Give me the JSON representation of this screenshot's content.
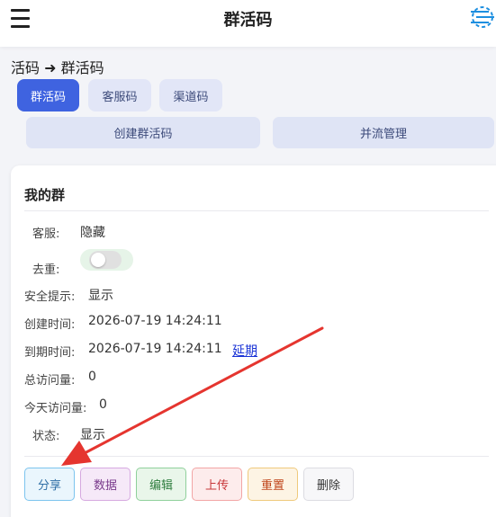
{
  "header": {
    "title": "群活码"
  },
  "breadcrumb": "活码 ➜ 群活码",
  "tabs": [
    {
      "label": "群活码",
      "active": true
    },
    {
      "label": "客服码",
      "active": false
    },
    {
      "label": "渠道码",
      "active": false
    }
  ],
  "actions": {
    "create": "创建群活码",
    "merge": "并流管理"
  },
  "card": {
    "title": "我的群",
    "rows": {
      "service": {
        "label": "客服:",
        "value": "隐藏"
      },
      "dedupe": {
        "label": "去重:",
        "enabled": false
      },
      "safety": {
        "label": "安全提示:",
        "value": "显示"
      },
      "created": {
        "label": "创建时间:",
        "value": "2026-07-19 14:24:11"
      },
      "expire": {
        "label": "到期时间:",
        "value": "2026-07-19 14:24:11",
        "link": "延期"
      },
      "total_visits": {
        "label": "总访问量:",
        "value": "0"
      },
      "today_visits": {
        "label": "今天访问量:",
        "value": "0"
      },
      "status": {
        "label": "状态:",
        "value": "显示"
      }
    },
    "buttons": {
      "share": "分享",
      "data": "数据",
      "edit": "编辑",
      "upload": "上传",
      "reset": "重置",
      "delete": "删除"
    }
  },
  "colors": {
    "primary": "#3f63e0",
    "tab_bg": "#e2e6f7",
    "link": "#1a33d6",
    "arrow": "#e5352f"
  }
}
